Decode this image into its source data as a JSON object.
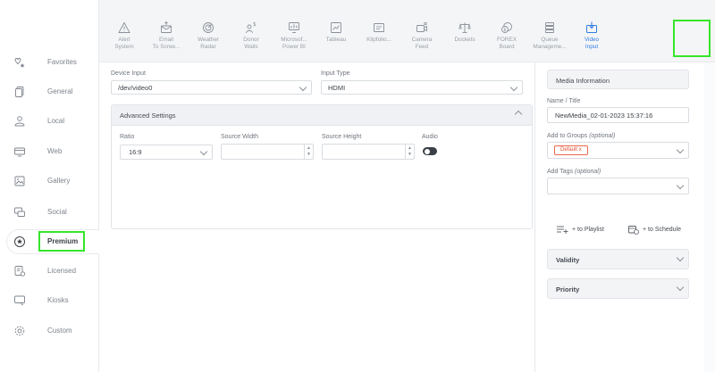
{
  "left_nav": {
    "items": [
      {
        "label": "Favorites",
        "icon": "favorites-star-icon"
      },
      {
        "label": "General",
        "icon": "copy-icon"
      },
      {
        "label": "Local",
        "icon": "users-icon"
      },
      {
        "label": "Web",
        "icon": "monitor-icon"
      },
      {
        "label": "Gallery",
        "icon": "gallery-icon"
      },
      {
        "label": "Social",
        "icon": "chat-icon"
      },
      {
        "label": "Premium",
        "icon": "premium-star-icon",
        "active": true
      },
      {
        "label": "Licensed",
        "icon": "licensed-doc-icon"
      },
      {
        "label": "Kiosks",
        "icon": "kiosk-icon"
      },
      {
        "label": "Custom",
        "icon": "gear-icon"
      }
    ]
  },
  "toolbar": {
    "items": [
      {
        "label": "Alert\nSystem",
        "icon": "warning-icon"
      },
      {
        "label": "Email\nTo Scree...",
        "icon": "email-icon"
      },
      {
        "label": "Weather\nRadar",
        "icon": "radar-icon"
      },
      {
        "label": "Donor\nWalls",
        "icon": "donor-icon"
      },
      {
        "label": "Microsof...\nPower BI",
        "icon": "powerbi-icon"
      },
      {
        "label": "Tableau",
        "icon": "tableau-icon"
      },
      {
        "label": "Klipfolio...",
        "icon": "klipfolio-icon"
      },
      {
        "label": "Camera\nFeed",
        "icon": "camera-icon"
      },
      {
        "label": "Dockets",
        "icon": "scales-icon"
      },
      {
        "label": "FOREX\nBoard",
        "icon": "forex-icon"
      },
      {
        "label": "Queue\nManageme...",
        "icon": "queue-icon"
      },
      {
        "label": "Video\nInput",
        "icon": "video-input-icon",
        "active": true
      }
    ]
  },
  "main": {
    "device_input_label": "Device Input",
    "device_input_value": "/dev/video0",
    "input_type_label": "Input Type",
    "input_type_value": "HDMI",
    "advanced_settings_title": "Advanced Settings",
    "ratio_label": "Ratio",
    "ratio_value": "16:9",
    "source_width_label": "Source Width",
    "source_width_value": "",
    "source_height_label": "Source Height",
    "source_height_value": "",
    "audio_label": "Audio"
  },
  "right_panel": {
    "media_information_title": "Media Information",
    "name_title_label": "Name / Title",
    "name_title_value": "NewMedia_02-01-2023 15:37:16",
    "add_to_groups_label": "Add to Groups",
    "add_to_groups_optional": "(optional)",
    "group_tag": "Default",
    "group_tag_remove": "x",
    "add_tags_label": "Add Tags",
    "add_tags_optional": "(optional)",
    "playlist_action": "+ to Playlist",
    "schedule_action": "+ to Schedule",
    "validity_title": "Validity",
    "priority_title": "Priority"
  },
  "colors": {
    "accent": "#2f7de0",
    "highlight": "#35e62a",
    "tag": "#e24a2a"
  }
}
